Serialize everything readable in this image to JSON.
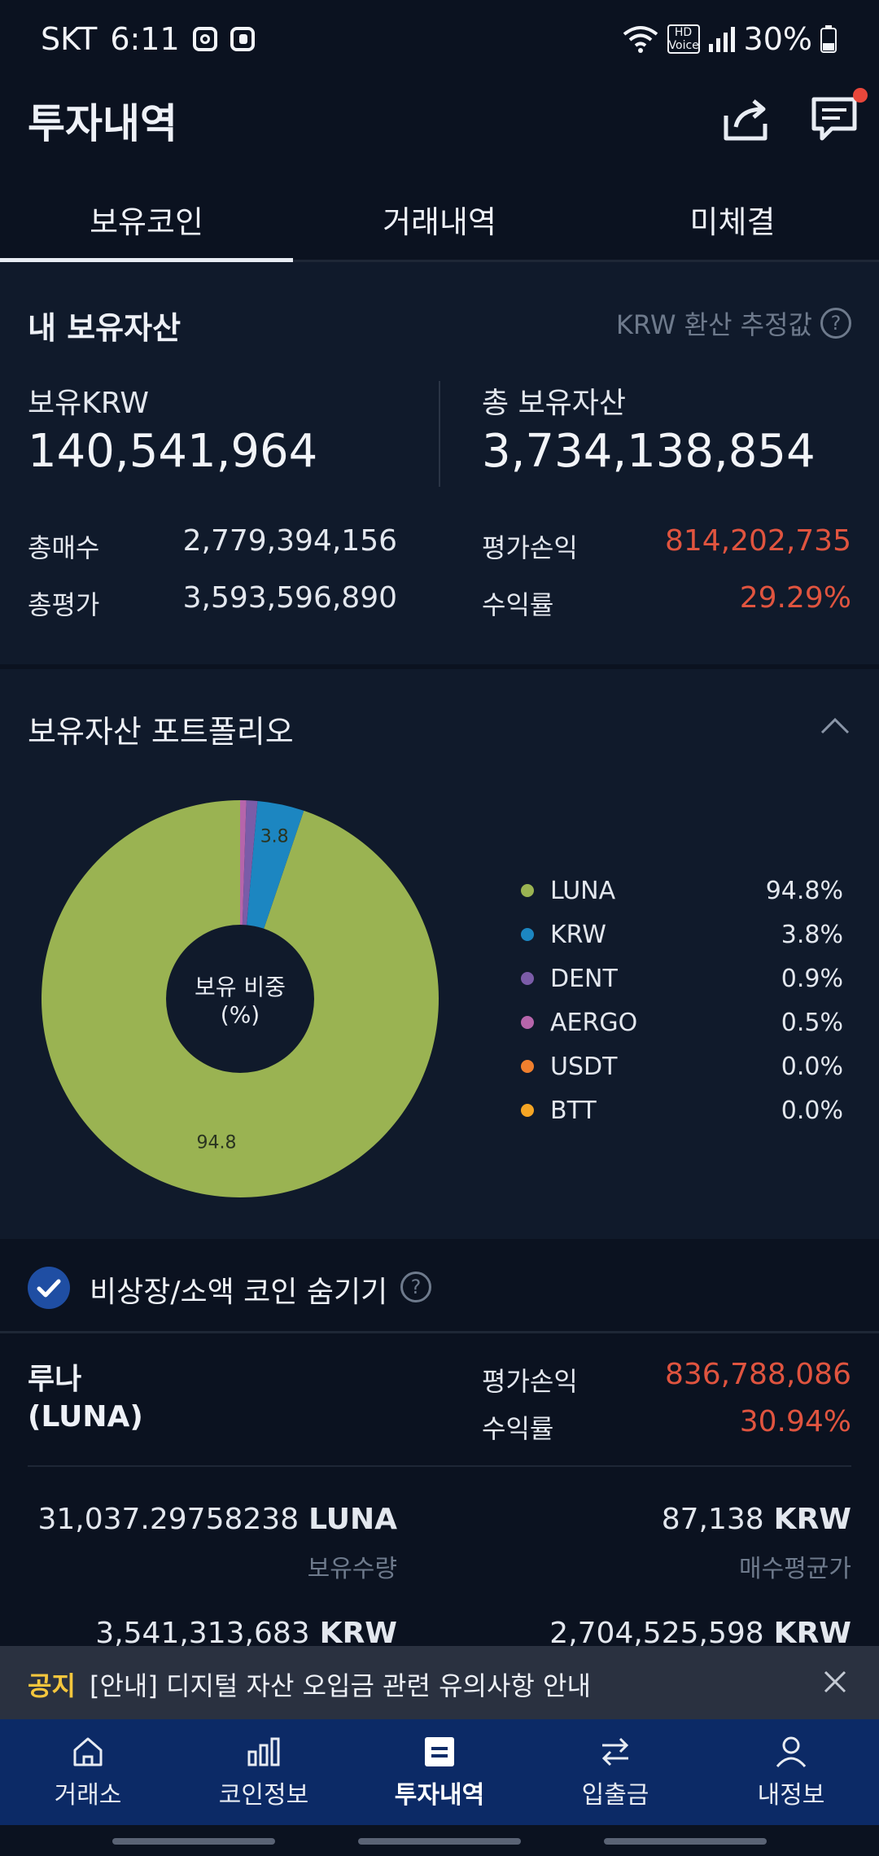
{
  "status_bar": {
    "carrier": "SKT",
    "time": "6:11",
    "hd_voice": "HD Voice",
    "battery": "30%"
  },
  "header": {
    "title": "투자내역"
  },
  "tabs": [
    {
      "label": "보유코인",
      "active": true
    },
    {
      "label": "거래내역",
      "active": false
    },
    {
      "label": "미체결",
      "active": false
    }
  ],
  "assets": {
    "title": "내 보유자산",
    "note": "KRW 환산 추정값",
    "krw_label": "보유KRW",
    "krw_value": "140,541,964",
    "total_label": "총 보유자산",
    "total_value": "3,734,138,854",
    "buy_label": "총매수",
    "buy_value": "2,779,394,156",
    "eval_label": "총평가",
    "eval_value": "3,593,596,890",
    "pnl_label": "평가손익",
    "pnl_value": "814,202,735",
    "rate_label": "수익률",
    "rate_value": "29.29%"
  },
  "portfolio": {
    "title": "보유자산 포트폴리오",
    "center_line1": "보유 비중",
    "center_line2": "(%)"
  },
  "chart_data": {
    "type": "pie",
    "donut": true,
    "categories": [
      "LUNA",
      "KRW",
      "DENT",
      "AERGO",
      "USDT",
      "BTT"
    ],
    "values": [
      94.8,
      3.8,
      0.9,
      0.5,
      0.0,
      0.0
    ],
    "legend_values": [
      "94.8%",
      "3.8%",
      "0.9%",
      "0.5%",
      "0.0%",
      "0.0%"
    ],
    "colors": [
      "#9ab352",
      "#1c86c1",
      "#7b5ca8",
      "#b665ab",
      "#f07f2e",
      "#f5a524"
    ],
    "slice_labels": [
      "94.8",
      "3.8"
    ],
    "legend_placement": "right"
  },
  "filter": {
    "label": "비상장/소액 코인 숨기기",
    "checked": true
  },
  "coin": {
    "name_line1": "루나",
    "name_line2": "(LUNA)",
    "pnl_label": "평가손익",
    "pnl_value": "836,788,086",
    "rate_label": "수익률",
    "rate_value": "30.94%",
    "qty_value": "31,037.29758238",
    "qty_unit": "LUNA",
    "qty_label": "보유수량",
    "avg_value": "87,138",
    "avg_unit": "KRW",
    "avg_label": "매수평균가",
    "eval_value": "3,541,313,683",
    "eval_unit": "KRW",
    "buy_value": "2,704,525,598",
    "buy_unit": "KRW"
  },
  "notice": {
    "tag": "공지",
    "text": "[안내] 디지털 자산 오입금 관련 유의사항 안내"
  },
  "nav": [
    {
      "label": "거래소",
      "icon": "home-icon"
    },
    {
      "label": "코인정보",
      "icon": "bar-chart-icon"
    },
    {
      "label": "투자내역",
      "icon": "list-icon"
    },
    {
      "label": "입출금",
      "icon": "swap-icon"
    },
    {
      "label": "내정보",
      "icon": "user-icon"
    }
  ]
}
